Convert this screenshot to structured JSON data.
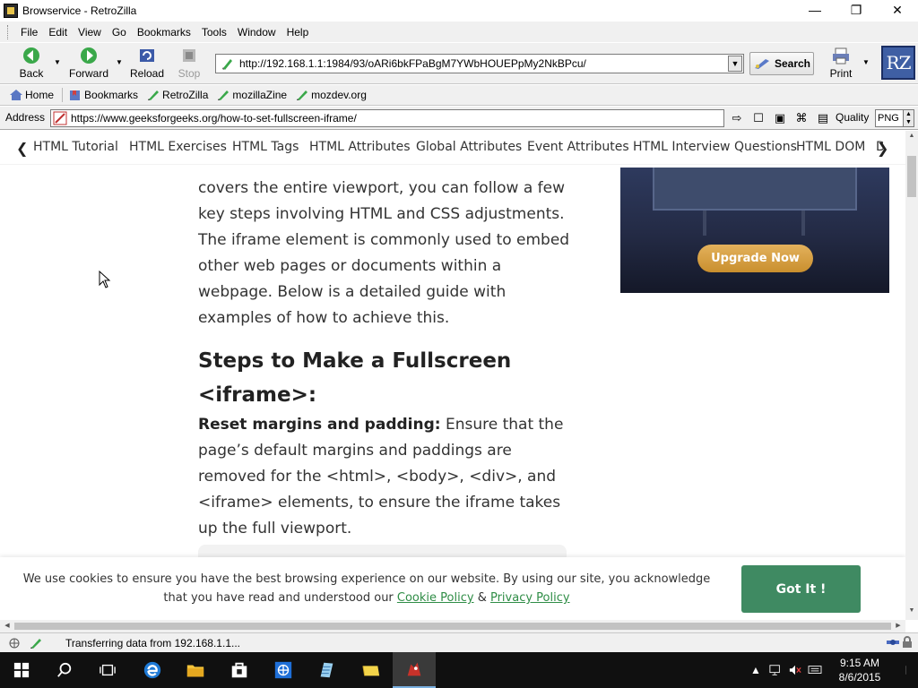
{
  "window": {
    "title": "Browservice - RetroZilla",
    "minimize": "—",
    "maximize": "❐",
    "close": "✕"
  },
  "menu": {
    "items": [
      "File",
      "Edit",
      "View",
      "Go",
      "Bookmarks",
      "Tools",
      "Window",
      "Help"
    ]
  },
  "toolbar": {
    "back": "Back",
    "forward": "Forward",
    "reload": "Reload",
    "stop": "Stop",
    "url": "http://192.168.1.1:1984/93/oARi6bkFPaBgM7YWbHOUEPpMy2NkBPcu/",
    "search": "Search",
    "print": "Print",
    "logo": "RZ"
  },
  "bookmarks": {
    "items": [
      "Home",
      "Bookmarks",
      "RetroZilla",
      "mozillaZine",
      "mozdev.org"
    ]
  },
  "address": {
    "label": "Address",
    "url": "https://www.geeksforgeeks.org/how-to-set-fullscreen-iframe/",
    "quality_label": "Quality",
    "quality_value": "PNG"
  },
  "topnav": {
    "links": [
      "HTML Tutorial",
      "HTML Exercises",
      "HTML Tags",
      "HTML Attributes",
      "Global Attributes",
      "Event Attributes",
      "HTML Interview Questions",
      "HTML DOM",
      "D"
    ]
  },
  "article": {
    "paragraph": "covers the entire viewport, you can follow a few key steps involving HTML and CSS adjustments. The iframe element is commonly used to embed other web pages or documents within a webpage. Below is a detailed guide with examples of how to achieve this.",
    "heading": "Steps to Make a Fullscreen <iframe>:",
    "step_title": "Reset margins and padding:",
    "step_text": " Ensure that the page’s default margins and paddings are removed for the <html>, <body>, <div>, and <iframe> elements, to ensure the iframe takes up the full viewport."
  },
  "ad": {
    "button": "Upgrade Now"
  },
  "cookie": {
    "text_before": "We use cookies to ensure you have the best browsing experience on our website. By using our site, you acknowledge that you have read and understood our ",
    "cookie_link": "Cookie Policy",
    "amp": " & ",
    "privacy_link": "Privacy Policy",
    "button": "Got It !"
  },
  "status": {
    "text": "Transferring data from 192.168.1.1..."
  },
  "taskbar": {
    "time": "9:15 AM",
    "date": "8/6/2015"
  },
  "colors": {
    "accent_green": "#3f8a62",
    "link_green": "#2f8d46",
    "ad_gold": "#d9a54a"
  }
}
